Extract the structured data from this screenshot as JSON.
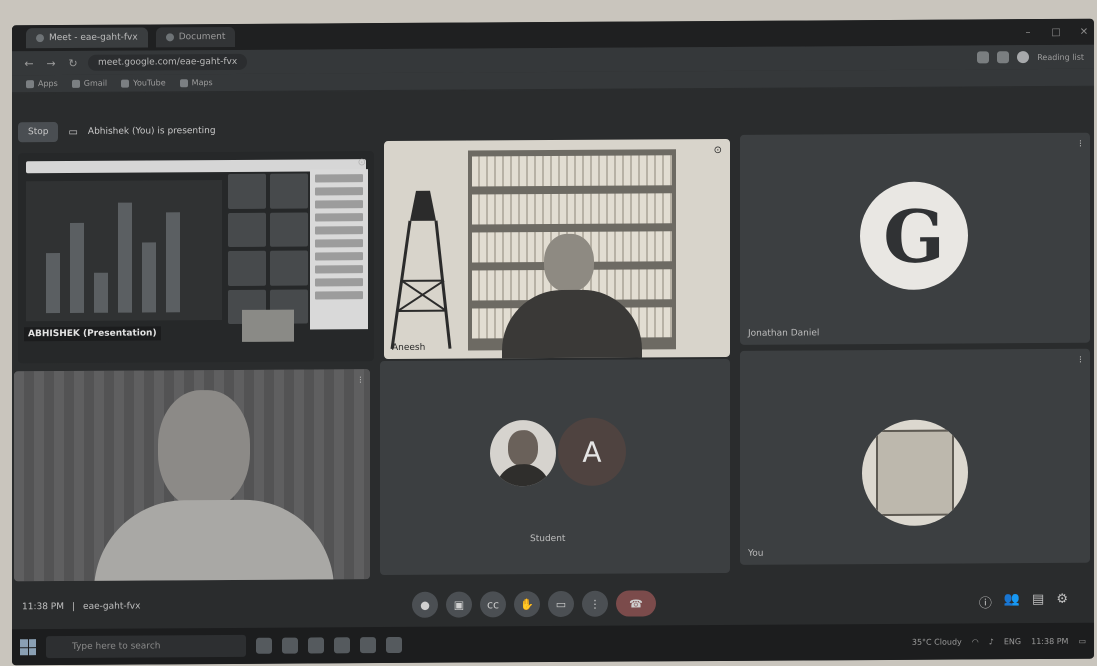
{
  "browser": {
    "tabs": [
      {
        "label": "Meet - eae-gaht-fvx",
        "active": true
      },
      {
        "label": "Document",
        "active": false
      }
    ],
    "url": "meet.google.com/eae-gaht-fvx",
    "side_label": "Reading list",
    "bookmarks": [
      "Apps",
      "Gmail",
      "YouTube",
      "Maps"
    ]
  },
  "meet": {
    "stop_button": "Stop",
    "presenting_text": "Abhishek (You) is presenting",
    "shared_caption": "ABHISHEK (Presentation)",
    "tiles": [
      {
        "name": ""
      },
      {
        "name": "Aneesh"
      },
      {
        "name": "Jonathan Daniel",
        "avatar_letter": "G"
      },
      {
        "name": ""
      },
      {
        "name": "Student",
        "avatar_letter": "A"
      },
      {
        "name": "You"
      }
    ],
    "time": "11:38 PM",
    "meeting_code": "eae-gaht-fvx",
    "controls": [
      "mic",
      "camera",
      "captions",
      "raise-hand",
      "present",
      "more",
      "leave"
    ]
  },
  "taskbar": {
    "search_placeholder": "Type here to search",
    "weather": "35°C Cloudy",
    "lang": "ENG",
    "clock": "11:38 PM"
  }
}
